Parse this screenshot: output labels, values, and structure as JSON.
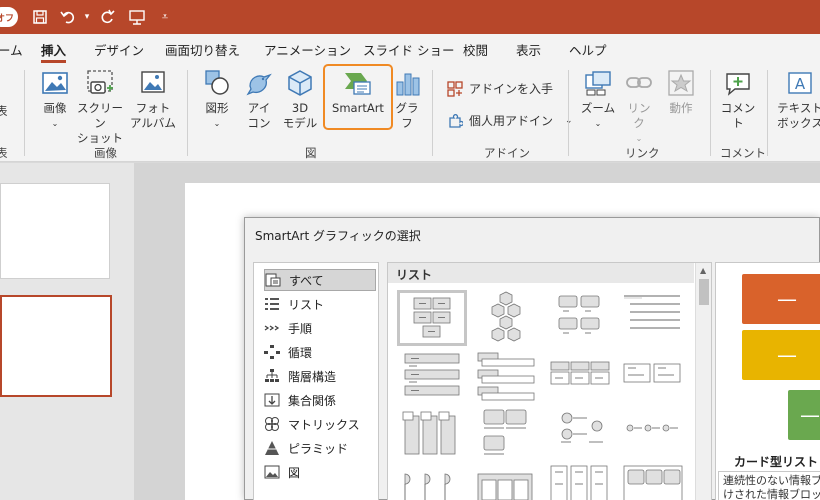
{
  "title_bar": {
    "autosave_label": "オフ",
    "color": "#b7472a"
  },
  "tabs": [
    {
      "label": "ーム"
    },
    {
      "label": "挿入"
    },
    {
      "label": "デザイン"
    },
    {
      "label": "画面切り替え"
    },
    {
      "label": "アニメーション"
    },
    {
      "label": "スライド ショー"
    },
    {
      "label": "校閲"
    },
    {
      "label": "表示"
    },
    {
      "label": "ヘルプ"
    }
  ],
  "ribbon": {
    "images": {
      "image_label": "画像",
      "screenshot_label": "スクリーン\nショット",
      "album_label": "フォト\nアルバム",
      "group_label": "画像",
      "left_cut_label": "表",
      "left_cut_group": "表"
    },
    "illustrations": {
      "shapes_label": "図形",
      "icons_label": "アイ\nコン",
      "model3d_label": "3D\nモデル",
      "smartart_label": "SmartArt",
      "chart_label": "グラフ",
      "group_label": "図"
    },
    "addins": {
      "get_addins_label": "アドインを入手",
      "my_addins_label": "個人用アドイン",
      "group_label": "アドイン"
    },
    "links": {
      "zoom_label": "ズーム",
      "link_label": "リンク",
      "action_label": "動作",
      "group_label": "リンク"
    },
    "comments": {
      "comment_label": "コメント",
      "group_label": "コメント"
    },
    "text": {
      "textbox_label": "テキスト\nボックス"
    }
  },
  "dialog": {
    "title": "SmartArt グラフィックの選択",
    "categories": [
      {
        "label": "すべて",
        "icon": "all-icon"
      },
      {
        "label": "リスト",
        "icon": "list-icon"
      },
      {
        "label": "手順",
        "icon": "process-icon"
      },
      {
        "label": "循環",
        "icon": "cycle-icon"
      },
      {
        "label": "階層構造",
        "icon": "hierarchy-icon"
      },
      {
        "label": "集合関係",
        "icon": "relationship-icon"
      },
      {
        "label": "マトリックス",
        "icon": "matrix-icon"
      },
      {
        "label": "ピラミッド",
        "icon": "pyramid-icon"
      },
      {
        "label": "図",
        "icon": "picture-icon"
      }
    ],
    "layouts_header": "リスト",
    "preview": {
      "title": "カード型リスト",
      "description_line1": "連続性のない情報ブ",
      "description_line2": "けされた情報ブロック",
      "bar_dash": "—",
      "colors": [
        "#d9622b",
        "#e8b400",
        "#6aa84f"
      ]
    }
  }
}
